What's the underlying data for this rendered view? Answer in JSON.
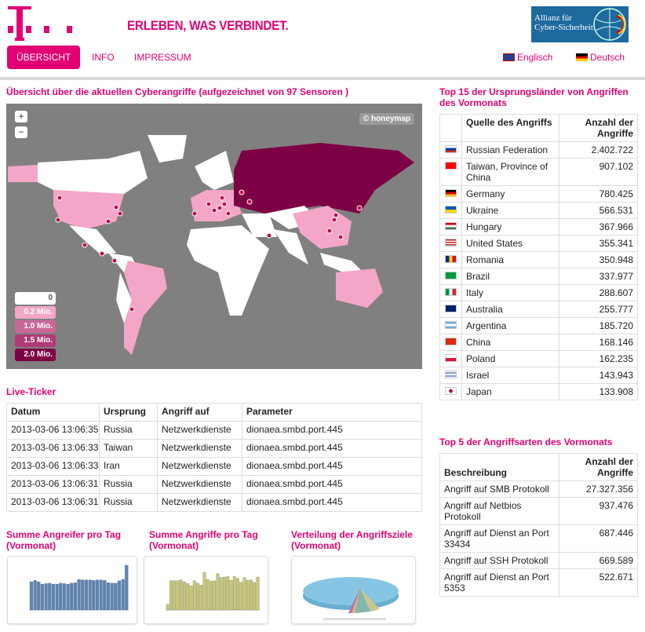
{
  "header": {
    "slogan": "ERLEBEN, WAS VERBINDET.",
    "partner_logo_line1": "Allianz für",
    "partner_logo_line2": "Cyber-Sicherheit"
  },
  "nav": {
    "items": [
      "ÜBERSICHT",
      "INFO",
      "IMPRESSUM"
    ],
    "active": "ÜBERSICHT",
    "lang_en": "Englisch",
    "lang_de": "Deutsch"
  },
  "map": {
    "title": "Übersicht über die aktuellen Cyberangriffe (aufgezeichnet von 97 Sensoren )",
    "zoom_in": "+",
    "zoom_out": "−",
    "attribution": "© honeymap",
    "legend": [
      {
        "label": "0",
        "color": "#ffffff"
      },
      {
        "label": "0.2 Mio.",
        "color": "#f4a6c8"
      },
      {
        "label": "1.0 Mio.",
        "color": "#cc6699"
      },
      {
        "label": "1.5 Mio.",
        "color": "#b03a78"
      },
      {
        "label": "2.0 Mio.",
        "color": "#7d0044"
      }
    ]
  },
  "ticker": {
    "title": "Live-Ticker",
    "columns": [
      "Datum",
      "Ursprung",
      "Angriff auf",
      "Parameter"
    ],
    "rows": [
      [
        "2013-03-06 13:06:35",
        "Russia",
        "Netzwerkdienste",
        "dionaea.smbd.port.445"
      ],
      [
        "2013-03-06 13:06:33",
        "Taiwan",
        "Netzwerkdienste",
        "dionaea.smbd.port.445"
      ],
      [
        "2013-03-06 13:06:33",
        "Iran",
        "Netzwerkdienste",
        "dionaea.smbd.port.445"
      ],
      [
        "2013-03-06 13:06:31",
        "Russia",
        "Netzwerkdienste",
        "dionaea.smbd.port.445"
      ],
      [
        "2013-03-06 13:06:31",
        "Russia",
        "Netzwerkdienste",
        "dionaea.smbd.port.445"
      ]
    ]
  },
  "charts": [
    {
      "title": "Summe Angreifer pro Tag (Vormonat)",
      "color": "#5b86b3",
      "values": [
        60,
        63,
        60,
        55,
        56,
        57,
        55,
        55,
        57,
        56,
        55,
        57,
        58,
        65,
        64,
        64,
        64,
        63,
        64,
        64,
        63,
        58,
        57,
        57,
        62,
        65,
        95
      ]
    },
    {
      "title": "Summe Angriffe pro Tag (Vormonat)",
      "color": "#c8c86e",
      "values": [
        12,
        62,
        62,
        62,
        64,
        60,
        56,
        51,
        62,
        57,
        53,
        80,
        65,
        61,
        62,
        77,
        69,
        70,
        71,
        63,
        71,
        67,
        59,
        69,
        63,
        64,
        59,
        70
      ]
    },
    {
      "title": "Verteilung der Angriffsziele (Vormonat)"
    }
  ],
  "top15": {
    "title": "Top 15 der Ursprungsländer von Angriffen des Vormonats",
    "col1": "Quelle des Angriffs",
    "col2": "Anzahl der Angriffe",
    "rows": [
      [
        "Russian Federation",
        "2.402.722",
        "ru"
      ],
      [
        "Taiwan, Province of China",
        "907.102",
        "tw"
      ],
      [
        "Germany",
        "780.425",
        "de"
      ],
      [
        "Ukraine",
        "566.531",
        "ua"
      ],
      [
        "Hungary",
        "367.966",
        "hu"
      ],
      [
        "United States",
        "355.341",
        "us"
      ],
      [
        "Romania",
        "350.948",
        "ro"
      ],
      [
        "Brazil",
        "337.977",
        "br"
      ],
      [
        "Italy",
        "288.607",
        "it"
      ],
      [
        "Australia",
        "255.777",
        "au"
      ],
      [
        "Argentina",
        "185.720",
        "ar"
      ],
      [
        "China",
        "168.146",
        "cn"
      ],
      [
        "Poland",
        "162.235",
        "pl"
      ],
      [
        "Israel",
        "143.943",
        "il"
      ],
      [
        "Japan",
        "133.908",
        "jp"
      ]
    ]
  },
  "top5": {
    "title": "Top 5 der Angriffsarten des Vormonats",
    "col1": "Beschreibung",
    "col2": "Anzahl der Angriffe",
    "rows": [
      [
        "Angriff auf SMB Protokoll",
        "27.327.356"
      ],
      [
        "Angriff auf Netbios Protokoll",
        "937.476"
      ],
      [
        "Angriff auf Dienst an Port 33434",
        "687.446"
      ],
      [
        "Angriff auf SSH Protokoll",
        "669.589"
      ],
      [
        "Angriff auf Dienst an Port 5353",
        "522.671"
      ]
    ]
  }
}
